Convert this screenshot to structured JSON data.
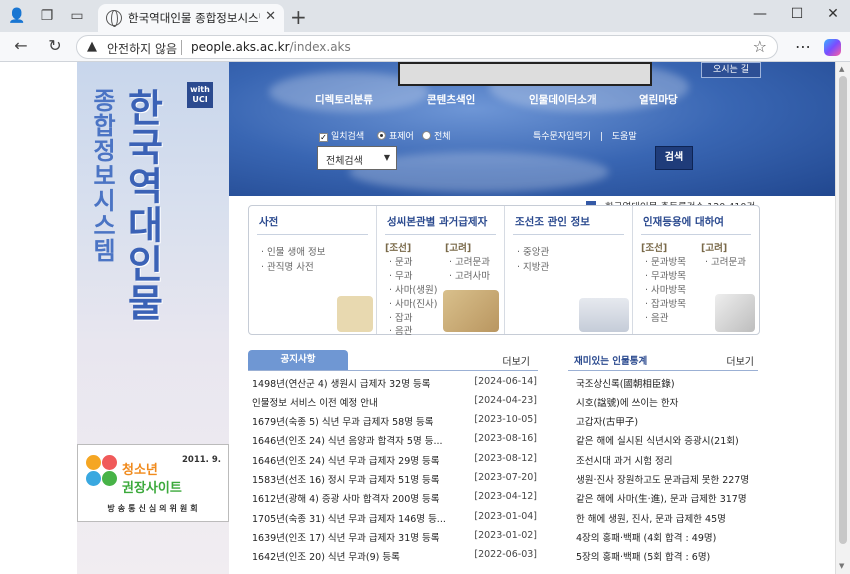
{
  "browser": {
    "tab_title": "한국역대인물 종합정보시스템 - 징",
    "insecure_label": "안전하지 않음",
    "url_host": "people.aks.ac.kr",
    "url_path": "/index.aks"
  },
  "sidebar": {
    "title_main": "한국역대인물",
    "title_sub": "종합정보시스템",
    "uci_badge": "with UCI",
    "banner": {
      "date": "2011. 9.",
      "line1": "청소년",
      "line2": "권장사이트",
      "org": "방송통신심의위원회"
    }
  },
  "hero": {
    "top_link": "오시는 길",
    "menu": [
      "디렉토리분류",
      "콘텐츠색인",
      "인물데이터소개",
      "열린마당"
    ],
    "search_options": {
      "exact": "일치검색",
      "expression": "표제어",
      "all": "전체"
    },
    "sublinks": [
      "특수문자입력기",
      "도움말"
    ],
    "select_value": "전체검색",
    "search_value": "",
    "search_button": "검색",
    "count_text": "한국역대인물 총등록건수 120,410건"
  },
  "cards": [
    {
      "title": "사전",
      "items": [
        "인물 생애 정보",
        "관직명 사전"
      ]
    },
    {
      "title": "성씨본관별 과거급제자",
      "groups": [
        {
          "label": "[조선]",
          "items": [
            "문과",
            "무과",
            "사마(생원)",
            "사마(진사)",
            "잡과",
            "음관"
          ]
        },
        {
          "label": "[고려]",
          "items": [
            "고려문과",
            "고려사마"
          ]
        }
      ]
    },
    {
      "title": "조선조 관인 정보",
      "items": [
        "중앙관",
        "지방관"
      ]
    },
    {
      "title": "인재등용에 대하여",
      "groups": [
        {
          "label": "[조선]",
          "items": [
            "문과방목",
            "무과방목",
            "사마방목",
            "잡과방목",
            "음관"
          ]
        },
        {
          "label": "[고려]",
          "items": [
            "고려문과"
          ]
        }
      ]
    }
  ],
  "notice": {
    "tab": "공지사항",
    "more": "더보기",
    "rows": [
      {
        "title": "1498년(연산군 4) 생원시 급제자 32명 등록",
        "date": "[2024-06-14]"
      },
      {
        "title": "인물정보 서비스 이전 예정 안내",
        "date": "[2024-04-23]"
      },
      {
        "title": "1679년(숙종 5) 식년 무과 급제자 58명 등록",
        "date": "[2023-10-05]"
      },
      {
        "title": "1646년(인조 24) 식년 음양과 합격자 5명 등...",
        "date": "[2023-08-16]"
      },
      {
        "title": "1646년(인조 24) 식년 무과 급제자 29명 등록",
        "date": "[2023-08-12]"
      },
      {
        "title": "1583년(선조 16) 정시 무과 급제자 51명 등록",
        "date": "[2023-07-20]"
      },
      {
        "title": "1612년(광해 4) 증광 사마 합격자 200명 등록",
        "date": "[2023-04-12]"
      },
      {
        "title": "1705년(숙종 31) 식년 무과 급제자 146명 등...",
        "date": "[2023-01-04]"
      },
      {
        "title": "1639년(인조 17) 식년 무과 급제자 31명 등록",
        "date": "[2023-01-02]"
      },
      {
        "title": "1642년(인조 20) 식년 무과(9) 등록",
        "date": "[2022-06-03]"
      }
    ]
  },
  "stats": {
    "title": "재미있는 인물통계",
    "more": "더보기",
    "rows": [
      "국조상신록(國朝相臣錄)",
      "시호(諡號)에 쓰이는 한자",
      "고갑자(古甲子)",
      "같은 해에 실시된 식년시와 증광시(21회)",
      "조선시대 과거 시험 정리",
      "생원·진사 장원하고도 문과급제 못한 227명",
      "같은 해에 사마(生·進), 문과 급제한 317명",
      "한 해에 생원, 진사, 문과 급제한 45명",
      "4장의 홍패·백패 (4회 합격 : 49명)",
      "5장의 홍패·백패 (5회 합격 : 6명)"
    ]
  }
}
